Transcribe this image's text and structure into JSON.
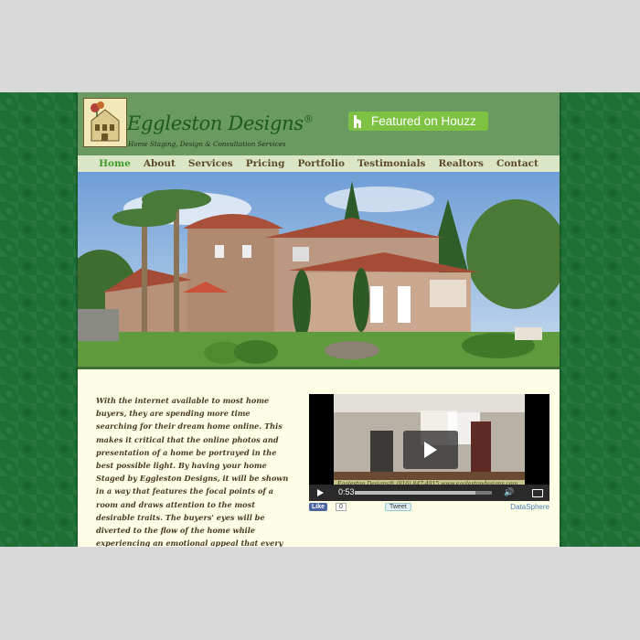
{
  "header": {
    "brand": "Eggleston Designs",
    "brand_mark": "®",
    "tagline": "Home Staging, Design & Consultation Services",
    "houzz_label": "Featured on Houzz"
  },
  "nav": {
    "items": [
      "Home",
      "About",
      "Services",
      "Pricing",
      "Portfolio",
      "Testimonials",
      "Realtors",
      "Contact"
    ],
    "active": "Home"
  },
  "intro_text": "With the internet available to most home buyers, they are spending more time searching for their dream home online. This makes it critical that the online photos and presentation of a home be portrayed in the best possible light. By having your home Staged by Eggleston Designs, it will be shown in a way that features the focal points of a room and draws attention to the most desirable traits. The buyers' eyes will be diverted to the flow of the home while experiencing an emotional appeal that every seller wants to create to",
  "video": {
    "time": "0:53",
    "progress": 0.88,
    "banner": "Eggleston Designs®   (916) 847-4915   www.egglestondesigns.com"
  },
  "social": {
    "like_label": "Like",
    "like_count": "0",
    "tweet_label": "Tweet",
    "datasphere_label": "DataSphere"
  },
  "colors": {
    "header_bg": "#6a9a60",
    "nav_bg": "#dbe6c6",
    "nav_active": "#3f9a2a",
    "page_bg": "#fefee6",
    "houzz_green": "#7dc243",
    "side_pattern": "#1d6f34"
  }
}
